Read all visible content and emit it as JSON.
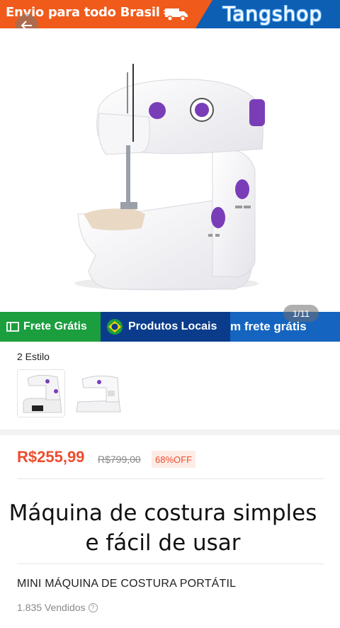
{
  "banner": {
    "left_text": "Envio para todo Brasil",
    "brand": "Tangshop",
    "truck_icon": "delivery-truck-icon",
    "colors": {
      "orange": "#f05a1a",
      "blue": "#0d5fb3"
    }
  },
  "back_icon": "arrow-left-icon",
  "product_image": {
    "subject": "sewing-machine",
    "counter": "1/11"
  },
  "features": {
    "frete": "Frete Grátis",
    "locais": "Produtos Locais",
    "trail": "m frete grátis",
    "colors": {
      "green": "#1b9e3e",
      "navy": "#0b3c8c",
      "blue": "#1565c0"
    }
  },
  "styles": {
    "label": "2 Estilo"
  },
  "pricing": {
    "price": "R$255,99",
    "original": "R$799,00",
    "discount": "68%OFF",
    "accent": "#ee4d2d"
  },
  "caption": {
    "line1": "Máquina de costura simples",
    "line2": "e fácil de usar"
  },
  "product": {
    "title": "MINI MÁQUINA DE COSTURA PORTÁTIL",
    "sold": "1.835 Vendidos"
  }
}
